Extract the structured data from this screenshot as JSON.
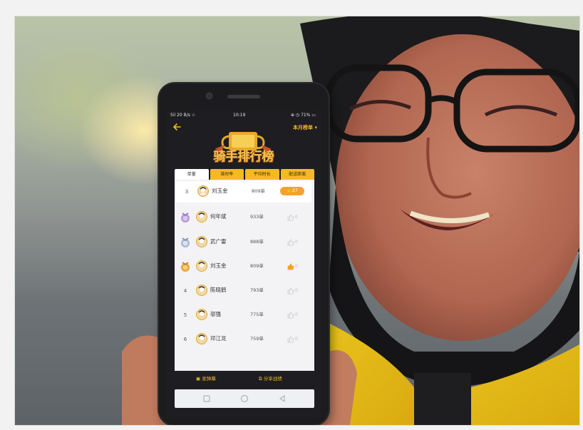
{
  "status_bar": {
    "left": "5il 20 B/s ☆",
    "time": "10:19",
    "right": "⊕ ◷ 71% ▭"
  },
  "header": {
    "period": "本月榜单 ▾",
    "title": "骑手排行榜"
  },
  "tabs": [
    "单量",
    "准时率",
    "平均时长",
    "配送距离"
  ],
  "my_row": {
    "rank": "3",
    "name": "刘玉金",
    "count": "809单",
    "likes": "27"
  },
  "rankings": [
    {
      "rank": "",
      "medal": "purple",
      "name": "何年斌",
      "count": "933单",
      "likes": "0"
    },
    {
      "rank": "",
      "medal": "silver",
      "name": "武广雷",
      "count": "888单",
      "likes": "0"
    },
    {
      "rank": "",
      "medal": "bronze",
      "name": "刘玉金",
      "count": "809单",
      "likes": "0"
    },
    {
      "rank": "4",
      "medal": "",
      "name": "陈晓鹤",
      "count": "793单",
      "likes": "0"
    },
    {
      "rank": "5",
      "medal": "",
      "name": "邬强",
      "count": "775单",
      "likes": "0"
    },
    {
      "rank": "6",
      "medal": "",
      "name": "邓江龙",
      "count": "759单",
      "likes": "0"
    }
  ],
  "bottom_actions": {
    "left": "发弹幕",
    "right": "分享战绩"
  },
  "colors": {
    "accent": "#f5b923",
    "like_orange": "#f7a12a",
    "screen_bg": "#1d1d22"
  }
}
